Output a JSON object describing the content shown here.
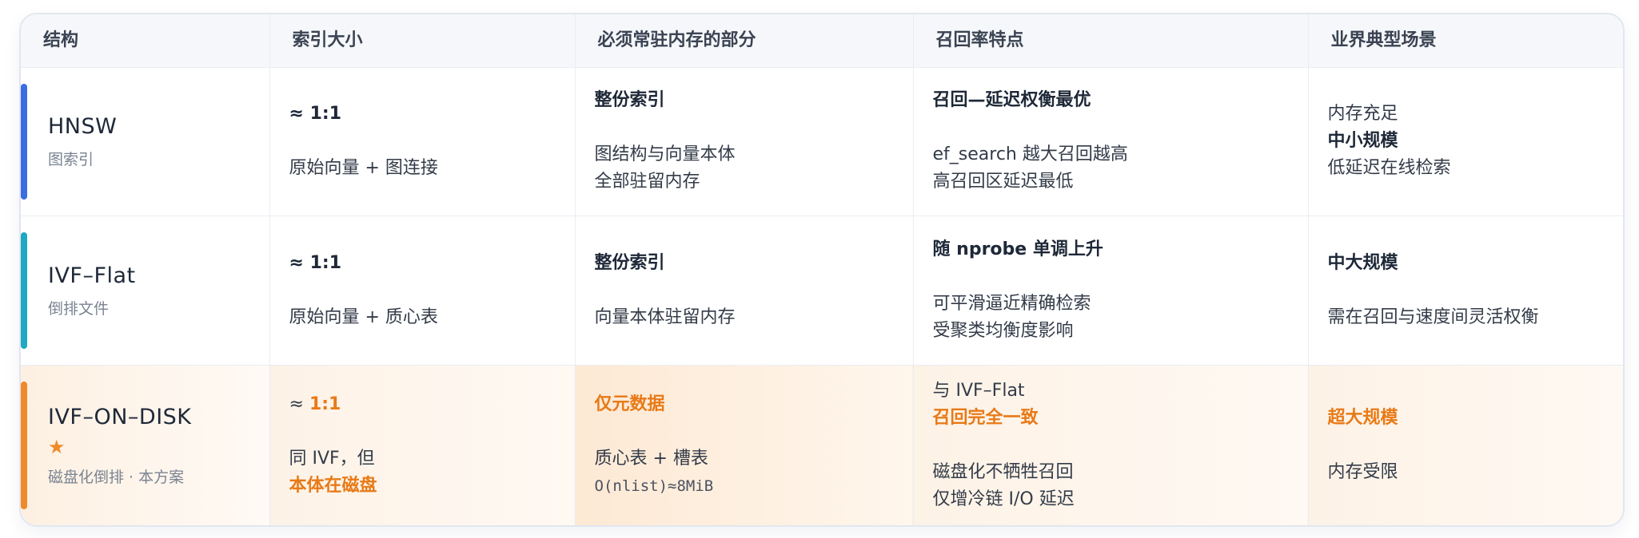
{
  "headers": [
    "结构",
    "索引大小",
    "必须常驻内存的部分",
    "召回率特点",
    "业界典型场景"
  ],
  "rows": [
    {
      "name": "HNSW",
      "sub": "图索引",
      "size_main": "≈ 1:1",
      "size_detail": "原始向量 + 图连接",
      "mem_main": "整份索引",
      "mem_line1": "图结构与向量本体",
      "mem_line2": "全部驻留内存",
      "recall_main": "召回—延迟权衡最优",
      "recall_line1": "ef_search 越大召回越高",
      "recall_line2": "高召回区延迟最低",
      "scene_line1": "内存充足",
      "scene_bold": "中小规模",
      "scene_line3": "低延迟在线检索"
    },
    {
      "name": "IVF–Flat",
      "sub": "倒排文件",
      "size_main": "≈ 1:1",
      "size_detail": "原始向量 + 质心表",
      "mem_main": "整份索引",
      "mem_line1": "向量本体驻留内存",
      "recall_main": "随 nprobe 单调上升",
      "recall_line1": "可平滑逼近精确检索",
      "recall_line2": "受聚类均衡度影响",
      "scene_bold": "中大规模",
      "scene_line2": "需在召回与速度间灵活权衡"
    },
    {
      "name": "IVF–ON–DISK",
      "star": "★",
      "sub": "磁盘化倒排 · 本方案",
      "size_prefix": "≈ ",
      "size_main": "1:1",
      "size_line1": "同 IVF，但",
      "size_orange": "本体在磁盘",
      "mem_main": "仅元数据",
      "mem_line1": "质心表 + 槽表",
      "mem_mono": "O(nlist)≈8MiB",
      "recall_line1": "与 IVF–Flat",
      "recall_orange": "召回完全一致",
      "recall_line2": "磁盘化不牺牲召回",
      "recall_line3": "仅增冷链 I/O 延迟",
      "scene_orange": "超大规模",
      "scene_line2": "内存受限"
    }
  ],
  "colors": {
    "hnsw_bar": "#3a6ee0",
    "ivfflat_bar": "#1fa8c2",
    "ondisk_bar": "#ef8a2a",
    "accent": "#e87a17"
  },
  "icons": {
    "star": "star-icon"
  }
}
